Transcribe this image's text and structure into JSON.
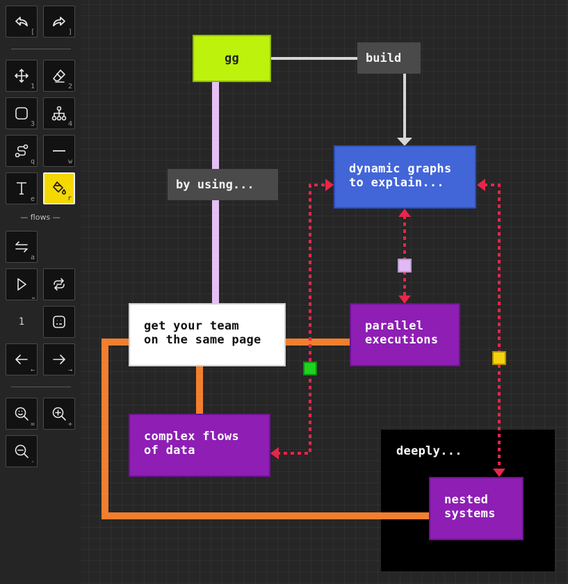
{
  "toolbar": {
    "undo_key": "[",
    "redo_key": "]",
    "move_key": "1",
    "eraser_key": "2",
    "box_key": "3",
    "tree_key": "4",
    "path_key": "q",
    "line_key": "w",
    "text_key": "e",
    "fill_key": "r",
    "flows_label": "— flows —",
    "swap_key": "a",
    "play_key": "⎵",
    "flow_counter": "1",
    "prev_key": "←",
    "next_key": "→",
    "zoom_reset_key": "=",
    "zoom_in_key": "+",
    "zoom_out_key": "-"
  },
  "diagram": {
    "nodes": {
      "gg": "gg",
      "build": "build",
      "by_using": "by using...",
      "dynamic": "dynamic graphs\nto explain...",
      "team": "get your team\non the same page",
      "parallel": "parallel\nexecutions",
      "complex": "complex flows\nof data",
      "deeply": "deeply...",
      "nested": "nested\nsystems"
    },
    "colors": {
      "gg": "#bdf20d",
      "label_bg": "#4a4a4a",
      "dynamic": "#4265d8",
      "team": "#ffffff",
      "purple": "#8e1eb4",
      "group": "#000000",
      "orange_edge": "#f27f2e",
      "lavender_edge": "#e6c0f5",
      "gray_edge": "#d6d6d6",
      "red_flow": "#e8254a",
      "port_lavender": "#e2b8f5",
      "port_green": "#1fd21f",
      "port_yellow": "#f5d20f",
      "accent": "#f5d800"
    }
  }
}
